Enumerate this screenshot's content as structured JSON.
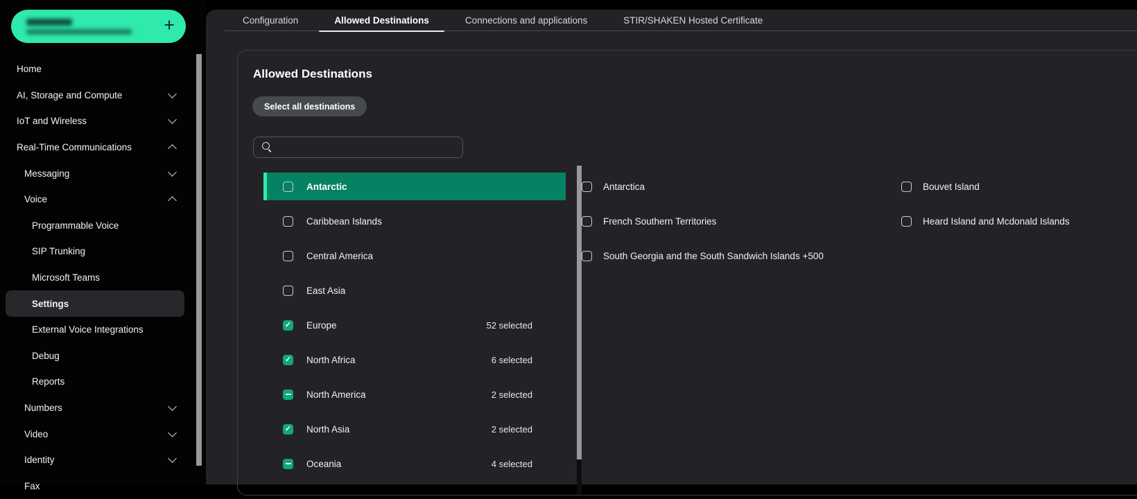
{
  "colors": {
    "accent": "#2FE9AD",
    "selected_row": "#058263",
    "checkbox_checked": "#10A877"
  },
  "sidebar": {
    "balance_pill": {
      "add_label": "+"
    },
    "items": [
      {
        "label": "Home",
        "level": 0
      },
      {
        "label": "AI, Storage and Compute",
        "level": 0,
        "chevron": "down"
      },
      {
        "label": "IoT and Wireless",
        "level": 0,
        "chevron": "down"
      },
      {
        "label": "Real-Time Communications",
        "level": 0,
        "chevron": "up"
      },
      {
        "label": "Messaging",
        "level": 1,
        "chevron": "down"
      },
      {
        "label": "Voice",
        "level": 1,
        "chevron": "up"
      },
      {
        "label": "Programmable Voice",
        "level": 2
      },
      {
        "label": "SIP Trunking",
        "level": 2
      },
      {
        "label": "Microsoft Teams",
        "level": 2
      },
      {
        "label": "Settings",
        "level": 2,
        "active": true
      },
      {
        "label": "External Voice Integrations",
        "level": 2
      },
      {
        "label": "Debug",
        "level": 2
      },
      {
        "label": "Reports",
        "level": 2
      },
      {
        "label": "Numbers",
        "level": 1,
        "chevron": "down"
      },
      {
        "label": "Video",
        "level": 1,
        "chevron": "down"
      },
      {
        "label": "Identity",
        "level": 1,
        "chevron": "down"
      },
      {
        "label": "Fax",
        "level": 1
      }
    ]
  },
  "tabs": [
    {
      "label": "Configuration",
      "active": false
    },
    {
      "label": "Allowed Destinations",
      "active": true
    },
    {
      "label": "Connections and applications",
      "active": false
    },
    {
      "label": "STIR/SHAKEN Hosted Certificate",
      "active": false
    }
  ],
  "card": {
    "title": "Allowed Destinations",
    "select_all_label": "Select all destinations",
    "search": {
      "placeholder": "",
      "value": ""
    }
  },
  "regions": [
    {
      "name": "Antarctic",
      "count": "",
      "state": "unchecked",
      "highlighted": true
    },
    {
      "name": "Caribbean Islands",
      "count": "",
      "state": "unchecked"
    },
    {
      "name": "Central America",
      "count": "",
      "state": "unchecked"
    },
    {
      "name": "East Asia",
      "count": "",
      "state": "unchecked"
    },
    {
      "name": "Europe",
      "count": "52 selected",
      "state": "checked"
    },
    {
      "name": "North Africa",
      "count": "6 selected",
      "state": "checked"
    },
    {
      "name": "North America",
      "count": "2 selected",
      "state": "indeterminate"
    },
    {
      "name": "North Asia",
      "count": "2 selected",
      "state": "checked"
    },
    {
      "name": "Oceania",
      "count": "4 selected",
      "state": "indeterminate"
    }
  ],
  "countries": {
    "column1": [
      {
        "name": "Antarctica",
        "state": "unchecked"
      },
      {
        "name": "French Southern Territories",
        "state": "unchecked"
      },
      {
        "name": "South Georgia and the South Sandwich Islands +500",
        "state": "unchecked"
      }
    ],
    "column2": [
      {
        "name": "Bouvet Island",
        "state": "unchecked"
      },
      {
        "name": "Heard Island and Mcdonald Islands",
        "state": "unchecked"
      }
    ]
  }
}
